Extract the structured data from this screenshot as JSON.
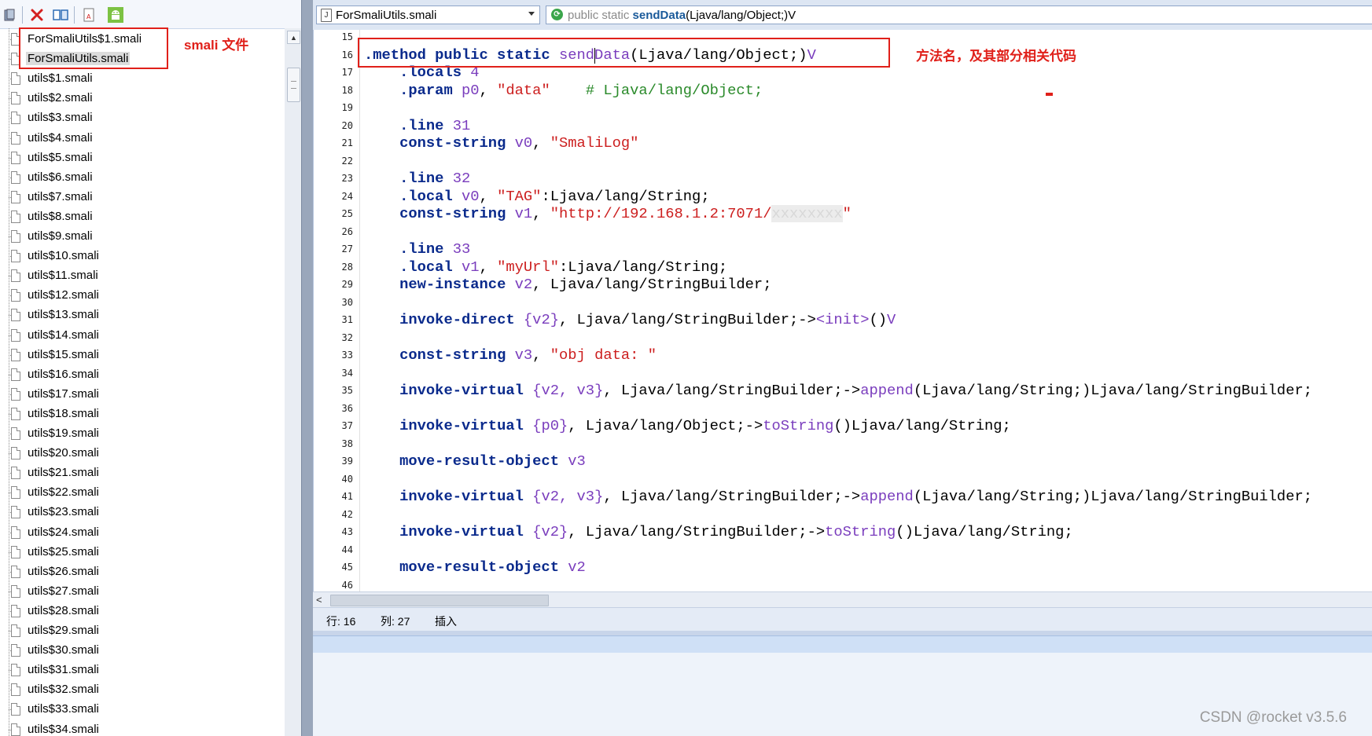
{
  "file_tree": {
    "items": [
      "ForSmaliUtils$1.smali",
      "ForSmaliUtils.smali",
      "utils$1.smali",
      "utils$2.smali",
      "utils$3.smali",
      "utils$4.smali",
      "utils$5.smali",
      "utils$6.smali",
      "utils$7.smali",
      "utils$8.smali",
      "utils$9.smali",
      "utils$10.smali",
      "utils$11.smali",
      "utils$12.smali",
      "utils$13.smali",
      "utils$14.smali",
      "utils$15.smali",
      "utils$16.smali",
      "utils$17.smali",
      "utils$18.smali",
      "utils$19.smali",
      "utils$20.smali",
      "utils$21.smali",
      "utils$22.smali",
      "utils$23.smali",
      "utils$24.smali",
      "utils$25.smali",
      "utils$26.smali",
      "utils$27.smali",
      "utils$28.smali",
      "utils$29.smali",
      "utils$30.smali",
      "utils$31.smali",
      "utils$32.smali",
      "utils$33.smali",
      "utils$34.smali"
    ],
    "selected": "ForSmaliUtils.smali"
  },
  "toolbar": {
    "icons": [
      "bookmark-icon",
      "delete-icon",
      "split-view-icon",
      "document-icon",
      "android-icon"
    ],
    "colors": {
      "delete": "#d42020",
      "android": "#7cc243",
      "split": "#2f6db5"
    }
  },
  "nav": {
    "file_combo": "ForSmaliUtils.smali",
    "method_prefix": "public static ",
    "method_name": "sendData",
    "method_suffix": "(Ljava/lang/Object;)V"
  },
  "editor": {
    "line_numbers": [
      "15",
      "16",
      "17",
      "18",
      "19",
      "20",
      "21",
      "22",
      "23",
      "24",
      "25",
      "26",
      "27",
      "28",
      "29",
      "30",
      "31",
      "32",
      "33",
      "34",
      "35",
      "36",
      "37",
      "38",
      "39",
      "40",
      "41",
      "42",
      "43",
      "44",
      "45",
      "46"
    ],
    "lines": [
      [],
      [
        [
          ".method public static",
          "kw"
        ],
        [
          " ",
          ""
        ],
        [
          "sendData",
          "mn"
        ],
        [
          "(Ljava/lang/Object;)",
          "typ"
        ],
        [
          "V",
          "mn"
        ]
      ],
      [
        [
          "    ",
          ""
        ],
        [
          ".locals",
          "kw"
        ],
        [
          " ",
          ""
        ],
        [
          "4",
          "num"
        ]
      ],
      [
        [
          "    ",
          ""
        ],
        [
          ".param",
          "kw"
        ],
        [
          " ",
          ""
        ],
        [
          "p0",
          "reg"
        ],
        [
          ", ",
          ""
        ],
        [
          "\"data\"",
          "str"
        ],
        [
          "    ",
          ""
        ],
        [
          "# Ljava/lang/Object;",
          "cm"
        ]
      ],
      [],
      [
        [
          "    ",
          ""
        ],
        [
          ".line",
          "kw"
        ],
        [
          " ",
          ""
        ],
        [
          "31",
          "num"
        ]
      ],
      [
        [
          "    ",
          ""
        ],
        [
          "const-string",
          "kw"
        ],
        [
          " ",
          ""
        ],
        [
          "v0",
          "reg"
        ],
        [
          ", ",
          ""
        ],
        [
          "\"SmaliLog\"",
          "str"
        ]
      ],
      [],
      [
        [
          "    ",
          ""
        ],
        [
          ".line",
          "kw"
        ],
        [
          " ",
          ""
        ],
        [
          "32",
          "num"
        ]
      ],
      [
        [
          "    ",
          ""
        ],
        [
          ".local",
          "kw"
        ],
        [
          " ",
          ""
        ],
        [
          "v0",
          "reg"
        ],
        [
          ", ",
          ""
        ],
        [
          "\"TAG\"",
          "str"
        ],
        [
          ":Ljava/lang/String;",
          "typ"
        ]
      ],
      [
        [
          "    ",
          ""
        ],
        [
          "const-string",
          "kw"
        ],
        [
          " ",
          ""
        ],
        [
          "v1",
          "reg"
        ],
        [
          ", ",
          ""
        ],
        [
          "\"http://192.168.1.2:7071/",
          "str"
        ],
        [
          "xxxxxxxx",
          "blur"
        ],
        [
          "\"",
          "str"
        ]
      ],
      [],
      [
        [
          "    ",
          ""
        ],
        [
          ".line",
          "kw"
        ],
        [
          " ",
          ""
        ],
        [
          "33",
          "num"
        ]
      ],
      [
        [
          "    ",
          ""
        ],
        [
          ".local",
          "kw"
        ],
        [
          " ",
          ""
        ],
        [
          "v1",
          "reg"
        ],
        [
          ", ",
          ""
        ],
        [
          "\"myUrl\"",
          "str"
        ],
        [
          ":Ljava/lang/String;",
          "typ"
        ]
      ],
      [
        [
          "    ",
          ""
        ],
        [
          "new-instance",
          "kw"
        ],
        [
          " ",
          ""
        ],
        [
          "v2",
          "reg"
        ],
        [
          ", Ljava/lang/StringBuilder;",
          "typ"
        ]
      ],
      [],
      [
        [
          "    ",
          ""
        ],
        [
          "invoke-direct",
          "kw"
        ],
        [
          " ",
          ""
        ],
        [
          "{v2}",
          "reg"
        ],
        [
          ", Ljava/lang/StringBuilder;->",
          "typ"
        ],
        [
          "<init>",
          "mn"
        ],
        [
          "()",
          "typ"
        ],
        [
          "V",
          "mn"
        ]
      ],
      [],
      [
        [
          "    ",
          ""
        ],
        [
          "const-string",
          "kw"
        ],
        [
          " ",
          ""
        ],
        [
          "v3",
          "reg"
        ],
        [
          ", ",
          ""
        ],
        [
          "\"obj data: \"",
          "str"
        ]
      ],
      [],
      [
        [
          "    ",
          ""
        ],
        [
          "invoke-virtual",
          "kw"
        ],
        [
          " ",
          ""
        ],
        [
          "{v2, v3}",
          "reg"
        ],
        [
          ", Ljava/lang/StringBuilder;->",
          "typ"
        ],
        [
          "append",
          "mn"
        ],
        [
          "(Ljava/lang/String;)Ljava/lang/StringBuilder;",
          "typ"
        ]
      ],
      [],
      [
        [
          "    ",
          ""
        ],
        [
          "invoke-virtual",
          "kw"
        ],
        [
          " ",
          ""
        ],
        [
          "{p0}",
          "reg"
        ],
        [
          ", Ljava/lang/Object;->",
          "typ"
        ],
        [
          "toString",
          "mn"
        ],
        [
          "()Ljava/lang/String;",
          "typ"
        ]
      ],
      [],
      [
        [
          "    ",
          ""
        ],
        [
          "move-result-object",
          "kw"
        ],
        [
          " ",
          ""
        ],
        [
          "v3",
          "reg"
        ]
      ],
      [],
      [
        [
          "    ",
          ""
        ],
        [
          "invoke-virtual",
          "kw"
        ],
        [
          " ",
          ""
        ],
        [
          "{v2, v3}",
          "reg"
        ],
        [
          ", Ljava/lang/StringBuilder;->",
          "typ"
        ],
        [
          "append",
          "mn"
        ],
        [
          "(Ljava/lang/String;)Ljava/lang/StringBuilder;",
          "typ"
        ]
      ],
      [],
      [
        [
          "    ",
          ""
        ],
        [
          "invoke-virtual",
          "kw"
        ],
        [
          " ",
          ""
        ],
        [
          "{v2}",
          "reg"
        ],
        [
          ", Ljava/lang/StringBuilder;->",
          "typ"
        ],
        [
          "toString",
          "mn"
        ],
        [
          "()Ljava/lang/String;",
          "typ"
        ]
      ],
      [],
      [
        [
          "    ",
          ""
        ],
        [
          "move-result-object",
          "kw"
        ],
        [
          " ",
          ""
        ],
        [
          "v2",
          "reg"
        ]
      ],
      []
    ]
  },
  "status": {
    "row_label": "行: 16",
    "col_label": "列: 27",
    "mode": "插入"
  },
  "annotations": {
    "files_label": "smali 文件",
    "method_label": "方法名，及其部分相关代码",
    "color": "#e0201a"
  },
  "watermark": "CSDN @rocket v3.5.6"
}
